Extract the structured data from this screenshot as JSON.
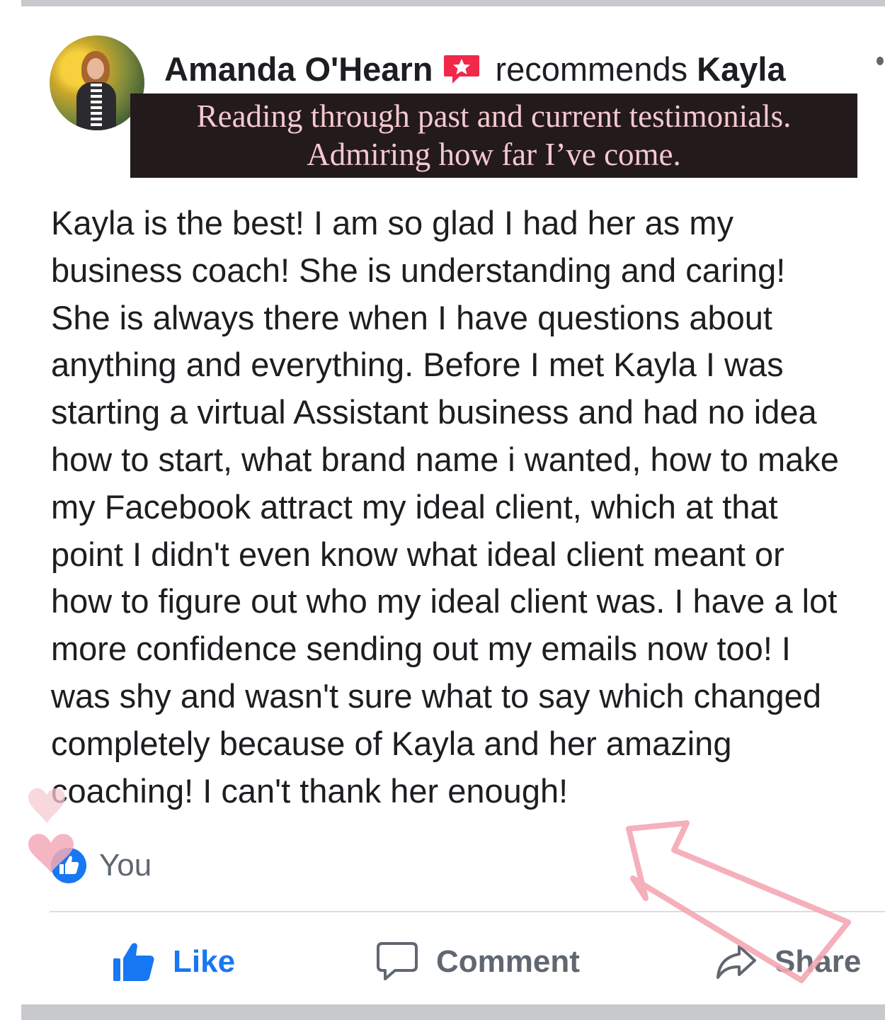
{
  "post": {
    "author": "Amanda O'Hearn",
    "action_text": "recommends",
    "recommended_name": "Kayla",
    "body_lines": [
      "Kayla is the best! I am so glad I had her as my",
      "business coach! She is understanding and caring!",
      "She is always there when I have questions about",
      "anything and everything. Before I met Kayla I was",
      "starting a virtual Assistant business and had no idea",
      "how to start, what brand name i wanted, how to make",
      "my Facebook attract my ideal client, which at that",
      "point I didn't even know what ideal client meant or",
      "how to figure out who my ideal client was. I have a lot",
      "more confidence sending out my emails now too! I",
      "was shy and wasn't sure what to say which changed",
      "completely because of Kayla and her amazing",
      "coaching! I can't thank her enough!"
    ]
  },
  "caption_overlay": {
    "line1": "Reading through past and current testimonials.",
    "line2": "Admiring how far I’ve come."
  },
  "reactions": {
    "label": "You"
  },
  "actions": {
    "like": "Like",
    "comment": "Comment",
    "share": "Share"
  },
  "colors": {
    "facebook_blue": "#1877f2",
    "recommend_red": "#f02849",
    "caption_bg": "#231a1b",
    "caption_text": "#f4c8cf",
    "overlay_pink": "#f4a7b4"
  }
}
